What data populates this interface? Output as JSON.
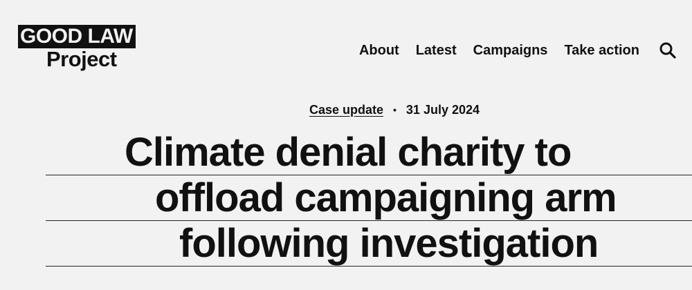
{
  "logo": {
    "line1": "GOOD LAW",
    "line2": "Project"
  },
  "nav": {
    "items": [
      {
        "label": "About"
      },
      {
        "label": "Latest"
      },
      {
        "label": "Campaigns"
      },
      {
        "label": "Take action"
      }
    ],
    "search_icon": "search-icon"
  },
  "article": {
    "category": "Case update",
    "separator": "•",
    "date": "31 July 2024",
    "headline_lines": [
      "Climate denial charity to",
      "offload campaigning arm",
      "following investigation"
    ]
  },
  "colors": {
    "background": "#f2f2f2",
    "text": "#111111",
    "logo_bg": "#111111"
  }
}
